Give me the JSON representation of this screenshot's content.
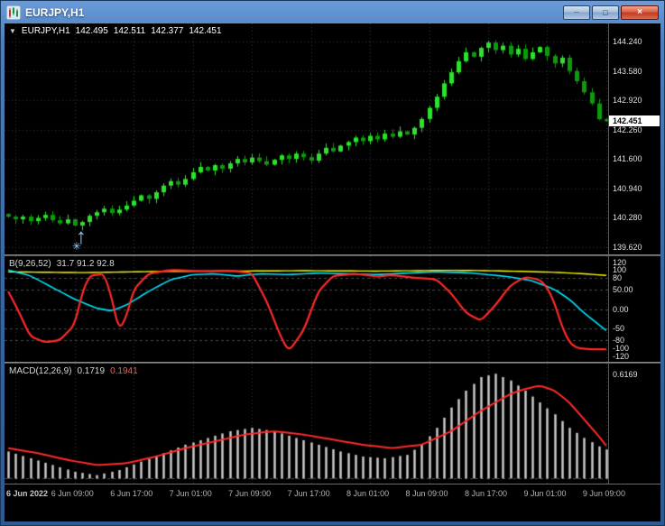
{
  "window": {
    "title": "EURJPY,H1",
    "icons": {
      "minimize": "_",
      "maximize": "□",
      "close": "×",
      "collapse": "▼"
    }
  },
  "quote": {
    "symbol": "EURJPY,H1",
    "open": "142.495",
    "high": "142.511",
    "low": "142.377",
    "close": "142.451"
  },
  "panes": {
    "oscillator": {
      "label": "B(9,26,52)",
      "values": "31.7 91.2 92.8"
    },
    "macd": {
      "label": "MACD(12,26,9)",
      "value_main": "0.1719",
      "value_signal": "0.1941"
    }
  },
  "scales": {
    "current_price": "142.451",
    "price": [
      {
        "v": 144.24,
        "t": "144.240"
      },
      {
        "v": 143.58,
        "t": "143.580"
      },
      {
        "v": 142.92,
        "t": "142.920"
      },
      {
        "v": 142.26,
        "t": "142.260"
      },
      {
        "v": 141.6,
        "t": "141.600"
      },
      {
        "v": 140.94,
        "t": "140.940"
      },
      {
        "v": 140.28,
        "t": "140.280"
      },
      {
        "v": 139.62,
        "t": "139.620"
      }
    ],
    "oscillator": [
      {
        "v": 120,
        "t": "120"
      },
      {
        "v": 100,
        "t": "100"
      },
      {
        "v": 80,
        "t": "80"
      },
      {
        "v": 50,
        "t": "50.00"
      },
      {
        "v": 0,
        "t": "0.00"
      },
      {
        "v": -50,
        "t": "-50"
      },
      {
        "v": -80,
        "t": "-80"
      },
      {
        "v": -100,
        "t": "-100"
      },
      {
        "v": -120,
        "t": "-120"
      }
    ],
    "macd": [
      {
        "v": 0.6169,
        "t": "0.6169"
      }
    ]
  },
  "colors": {
    "bull": "#2ce32c",
    "bear": "#0c9b0c",
    "grid": "#3a3a3a",
    "level": "#4a4a4a",
    "yellow": "#ffff00",
    "cyan": "#00e5ff",
    "red": "#ff2a2a",
    "histogram": "#c9c9c9",
    "marker_blue": "#8ec1ee"
  },
  "chart_data": {
    "type": "candlestick",
    "title": "EURJPY,H1",
    "bars": 82,
    "price": {
      "ylim": [
        139.45,
        144.65
      ],
      "first_open": 140.36,
      "closes": [
        140.3,
        140.24,
        140.3,
        140.2,
        140.27,
        140.34,
        140.22,
        140.15,
        140.24,
        140.1,
        140.18,
        140.32,
        140.4,
        140.48,
        140.38,
        140.46,
        140.55,
        140.66,
        140.78,
        140.7,
        140.85,
        141.0,
        141.1,
        141.02,
        141.15,
        141.3,
        141.42,
        141.34,
        141.46,
        141.38,
        141.5,
        141.6,
        141.52,
        141.63,
        141.55,
        141.47,
        141.58,
        141.68,
        141.6,
        141.72,
        141.64,
        141.56,
        141.72,
        141.85,
        141.77,
        141.9,
        141.98,
        142.08,
        142.0,
        142.12,
        142.04,
        142.17,
        142.1,
        142.22,
        142.15,
        142.3,
        142.5,
        142.75,
        143.0,
        143.3,
        143.55,
        143.8,
        144.0,
        143.9,
        144.1,
        144.22,
        144.05,
        144.15,
        143.95,
        144.08,
        143.85,
        144.0,
        144.12,
        143.92,
        143.75,
        143.88,
        143.58,
        143.35,
        143.1,
        142.85,
        142.495,
        142.451
      ]
    },
    "oscillator": {
      "ylim": [
        -135,
        135
      ],
      "levels": [
        80,
        50,
        0,
        -50,
        -80
      ],
      "series": [
        {
          "name": "yellow-line",
          "color_key": "yellow",
          "width": 1.4,
          "points": [
            [
              0,
              95
            ],
            [
              10,
              93
            ],
            [
              20,
              96
            ],
            [
              30,
              97
            ],
            [
              40,
              98
            ],
            [
              50,
              97
            ],
            [
              60,
              99
            ],
            [
              65,
              98
            ],
            [
              70,
              96
            ],
            [
              74,
              94
            ],
            [
              78,
              90
            ],
            [
              81,
              86
            ]
          ]
        },
        {
          "name": "cyan-line",
          "color_key": "cyan",
          "width": 1.6,
          "points": [
            [
              0,
              100
            ],
            [
              3,
              85
            ],
            [
              6,
              55
            ],
            [
              9,
              25
            ],
            [
              12,
              2
            ],
            [
              14,
              -5
            ],
            [
              16,
              10
            ],
            [
              19,
              45
            ],
            [
              22,
              75
            ],
            [
              25,
              88
            ],
            [
              28,
              90
            ],
            [
              31,
              84
            ],
            [
              34,
              90
            ],
            [
              38,
              88
            ],
            [
              42,
              92
            ],
            [
              46,
              90
            ],
            [
              50,
              88
            ],
            [
              54,
              92
            ],
            [
              58,
              95
            ],
            [
              62,
              93
            ],
            [
              65,
              88
            ],
            [
              68,
              82
            ],
            [
              71,
              72
            ],
            [
              74,
              50
            ],
            [
              76,
              25
            ],
            [
              78,
              -10
            ],
            [
              80,
              -40
            ],
            [
              81,
              -55
            ]
          ]
        },
        {
          "name": "red-line",
          "color_key": "red",
          "width": 2.2,
          "points": [
            [
              0,
              45
            ],
            [
              1,
              10
            ],
            [
              3,
              -70
            ],
            [
              5,
              -85
            ],
            [
              7,
              -80
            ],
            [
              9,
              -40
            ],
            [
              10,
              40
            ],
            [
              11,
              85
            ],
            [
              13,
              90
            ],
            [
              14,
              30
            ],
            [
              15,
              -55
            ],
            [
              16,
              -20
            ],
            [
              17,
              50
            ],
            [
              19,
              90
            ],
            [
              22,
              100
            ],
            [
              26,
              97
            ],
            [
              30,
              98
            ],
            [
              33,
              92
            ],
            [
              35,
              20
            ],
            [
              37,
              -75
            ],
            [
              38,
              -108
            ],
            [
              40,
              -55
            ],
            [
              42,
              45
            ],
            [
              44,
              85
            ],
            [
              47,
              90
            ],
            [
              50,
              83
            ],
            [
              52,
              87
            ],
            [
              55,
              80
            ],
            [
              58,
              76
            ],
            [
              60,
              40
            ],
            [
              62,
              -10
            ],
            [
              64,
              -30
            ],
            [
              66,
              10
            ],
            [
              68,
              60
            ],
            [
              70,
              82
            ],
            [
              72,
              75
            ],
            [
              73,
              55
            ],
            [
              74,
              15
            ],
            [
              75,
              -45
            ],
            [
              76,
              -85
            ],
            [
              77,
              -100
            ],
            [
              79,
              -103
            ],
            [
              81,
              -103
            ]
          ]
        }
      ]
    },
    "macd": {
      "ylim": [
        -0.03,
        0.68
      ],
      "histogram": [
        [
          0,
          0.16
        ],
        [
          3,
          0.12
        ],
        [
          6,
          0.08
        ],
        [
          9,
          0.04
        ],
        [
          12,
          0.02
        ],
        [
          15,
          0.05
        ],
        [
          18,
          0.1
        ],
        [
          21,
          0.15
        ],
        [
          24,
          0.2
        ],
        [
          27,
          0.24
        ],
        [
          30,
          0.28
        ],
        [
          33,
          0.3
        ],
        [
          36,
          0.28
        ],
        [
          39,
          0.24
        ],
        [
          42,
          0.2
        ],
        [
          45,
          0.16
        ],
        [
          48,
          0.13
        ],
        [
          51,
          0.12
        ],
        [
          54,
          0.14
        ],
        [
          56,
          0.2
        ],
        [
          58,
          0.3
        ],
        [
          60,
          0.42
        ],
        [
          62,
          0.52
        ],
        [
          64,
          0.6
        ],
        [
          66,
          0.62
        ],
        [
          68,
          0.58
        ],
        [
          70,
          0.52
        ],
        [
          72,
          0.45
        ],
        [
          74,
          0.38
        ],
        [
          76,
          0.3
        ],
        [
          78,
          0.24
        ],
        [
          80,
          0.19
        ],
        [
          81,
          0.172
        ]
      ],
      "signal": [
        [
          0,
          0.18
        ],
        [
          4,
          0.15
        ],
        [
          8,
          0.11
        ],
        [
          12,
          0.08
        ],
        [
          16,
          0.09
        ],
        [
          20,
          0.13
        ],
        [
          24,
          0.18
        ],
        [
          28,
          0.22
        ],
        [
          32,
          0.26
        ],
        [
          36,
          0.28
        ],
        [
          40,
          0.26
        ],
        [
          44,
          0.23
        ],
        [
          48,
          0.2
        ],
        [
          52,
          0.18
        ],
        [
          56,
          0.2
        ],
        [
          60,
          0.28
        ],
        [
          64,
          0.4
        ],
        [
          68,
          0.5
        ],
        [
          70,
          0.53
        ],
        [
          72,
          0.55
        ],
        [
          74,
          0.52
        ],
        [
          76,
          0.45
        ],
        [
          78,
          0.35
        ],
        [
          80,
          0.25
        ],
        [
          81,
          0.194
        ]
      ]
    },
    "time_axis": [
      {
        "t": "6 Jun 2022",
        "bar": 1
      },
      {
        "t": "6 Jun 09:00",
        "bar": 9
      },
      {
        "t": "6 Jun 17:00",
        "bar": 17
      },
      {
        "t": "7 Jun 01:00",
        "bar": 25
      },
      {
        "t": "7 Jun 09:00",
        "bar": 33
      },
      {
        "t": "7 Jun 17:00",
        "bar": 41
      },
      {
        "t": "8 Jun 01:00",
        "bar": 49
      },
      {
        "t": "8 Jun 09:00",
        "bar": 57
      },
      {
        "t": "8 Jun 17:00",
        "bar": 65
      },
      {
        "t": "9 Jun 01:00",
        "bar": 73
      },
      {
        "t": "9 Jun 09:00",
        "bar": 81
      }
    ],
    "markers": [
      {
        "type": "up-arrow",
        "glyph": "↑",
        "bar": 10,
        "price": 140.02
      },
      {
        "type": "snowflake",
        "glyph": "✳",
        "bar": 9.5,
        "price": 139.7
      }
    ]
  }
}
